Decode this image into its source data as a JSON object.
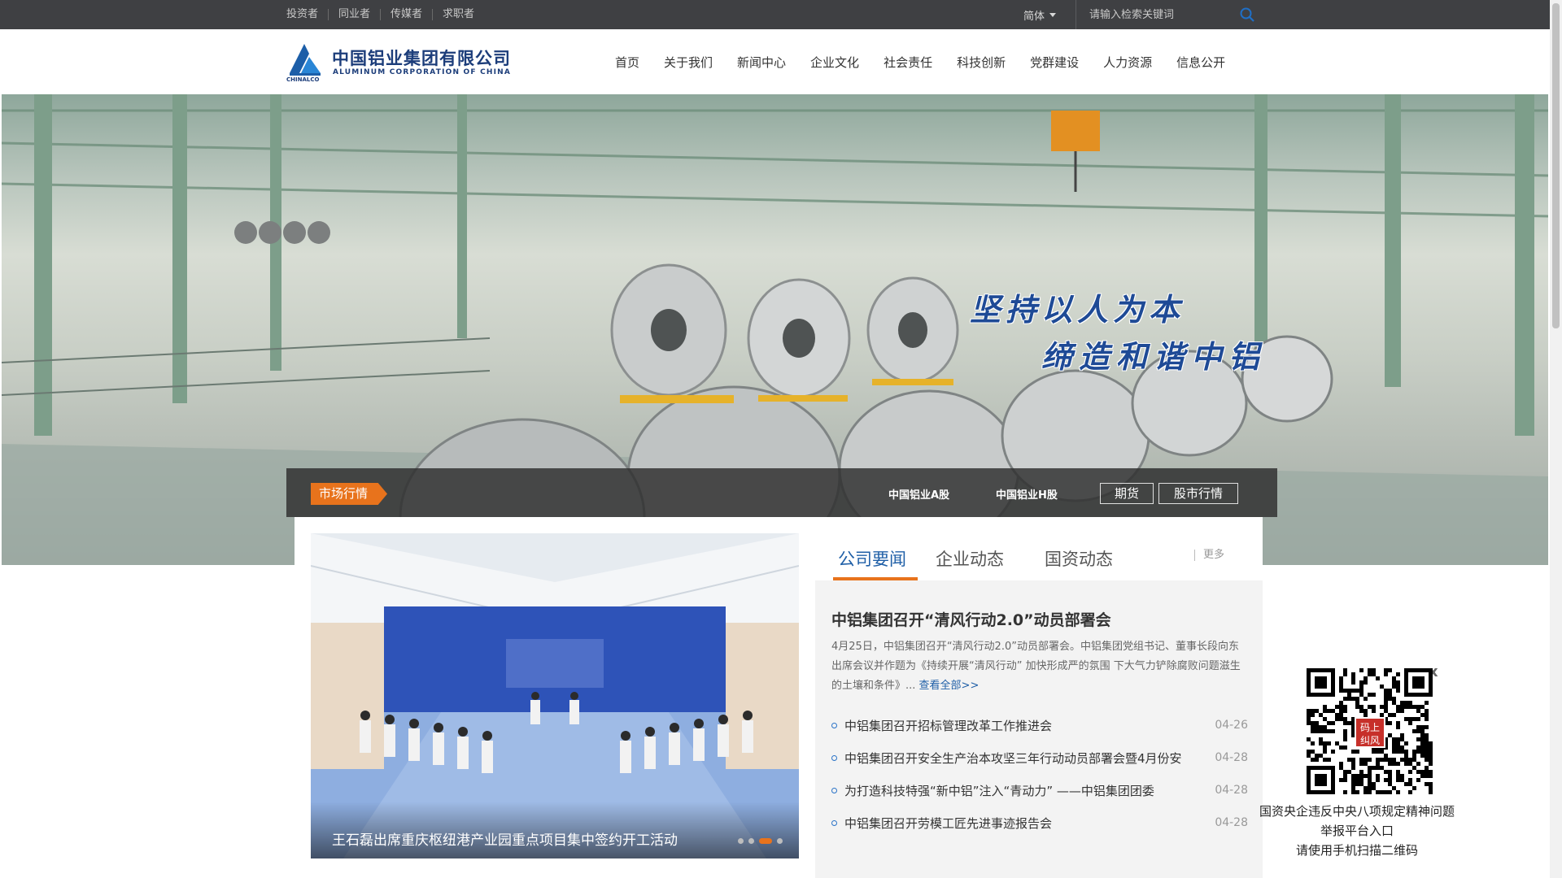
{
  "topbar": {
    "links": [
      "投资者",
      "同业者",
      "传媒者",
      "求职者"
    ],
    "language": "简体",
    "search_placeholder": "请输入检索关键词"
  },
  "header": {
    "logo_cn": "中国铝业集团有限公司",
    "logo_en": "ALUMINUM CORPORATION OF CHINA",
    "logo_sub": "CHINALCO",
    "nav": [
      "首页",
      "关于我们",
      "新闻中心",
      "企业文化",
      "社会责任",
      "科技创新",
      "党群建设",
      "人力资源",
      "信息公开"
    ]
  },
  "banner": {
    "slogan_line1": "坚持以人为本",
    "slogan_line2": "缔造和谐中铝"
  },
  "market": {
    "tag": "市场行情",
    "a_share": "中国铝业A股",
    "h_share": "中国铝业H股",
    "futures": "期货",
    "stock": "股市行情"
  },
  "slider": {
    "caption": "王石磊出席重庆枢纽港产业园重点项目集中签约开工活动",
    "active_dot": 2,
    "dot_count": 4
  },
  "news": {
    "tabs": [
      "公司要闻",
      "企业动态",
      "国资动态"
    ],
    "active_tab": 0,
    "more": "更多",
    "headline": "中铝集团召开“清风行动2.0”动员部署会",
    "summary": "4月25日，中铝集团召开“清风行动2.0”动员部署会。中铝集团党组书记、董事长段向东出席会议并作题为《持续开展“清风行动” 加快形成严的氛围 下大气力铲除腐败问题滋生的土壤和条件》...",
    "read_more": "查看全部>>",
    "items": [
      {
        "title": "中铝集团召开招标管理改革工作推进会",
        "date": "04-26"
      },
      {
        "title": "中铝集团召开安全生产治本攻坚三年行动动员部署会暨4月份安",
        "date": "04-28"
      },
      {
        "title": "为打造科技特强“新中铝”注入“青动力” ——中铝集团团委",
        "date": "04-28"
      },
      {
        "title": "中铝集团召开劳模工匠先进事迹报告会",
        "date": "04-28"
      }
    ]
  },
  "qr_popup": {
    "close": "x",
    "badge": "码上纠风",
    "line1": "国资央企违反中央八项规定精神问题",
    "line2": "举报平台入口",
    "line3": "请使用手机扫描二维码"
  },
  "colors": {
    "accent": "#e8731c",
    "brand_blue": "#1f5fa7",
    "topbar_bg": "#3f4043"
  }
}
